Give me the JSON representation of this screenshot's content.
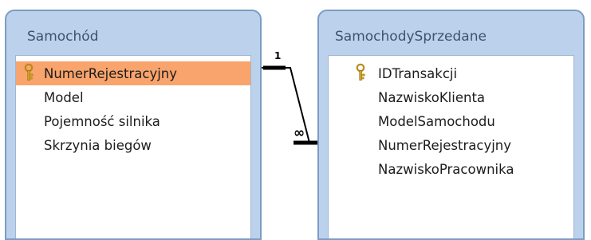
{
  "tables": [
    {
      "title": "Samochód",
      "fields": [
        {
          "label": "NumerRejestracyjny",
          "primary_key": true,
          "selected": true
        },
        {
          "label": "Model",
          "primary_key": false,
          "selected": false
        },
        {
          "label": "Pojemność silnika",
          "primary_key": false,
          "selected": false
        },
        {
          "label": "Skrzynia biegów",
          "primary_key": false,
          "selected": false
        }
      ]
    },
    {
      "title": "SamochodySprzedane",
      "fields": [
        {
          "label": "IDTransakcji",
          "primary_key": true,
          "selected": false
        },
        {
          "label": "NazwiskoKlienta",
          "primary_key": false,
          "selected": false
        },
        {
          "label": "ModelSamochodu",
          "primary_key": false,
          "selected": false
        },
        {
          "label": "NumerRejestracyjny",
          "primary_key": false,
          "selected": false
        },
        {
          "label": "NazwiskoPracownika",
          "primary_key": false,
          "selected": false
        }
      ]
    }
  ],
  "relationship": {
    "one_label": "1",
    "many_label": "∞"
  },
  "colors": {
    "table_header": "#bcd2ec",
    "table_border": "#7e9cc4",
    "selected_row": "#f8a46c",
    "key_icon": "#d9a825"
  }
}
